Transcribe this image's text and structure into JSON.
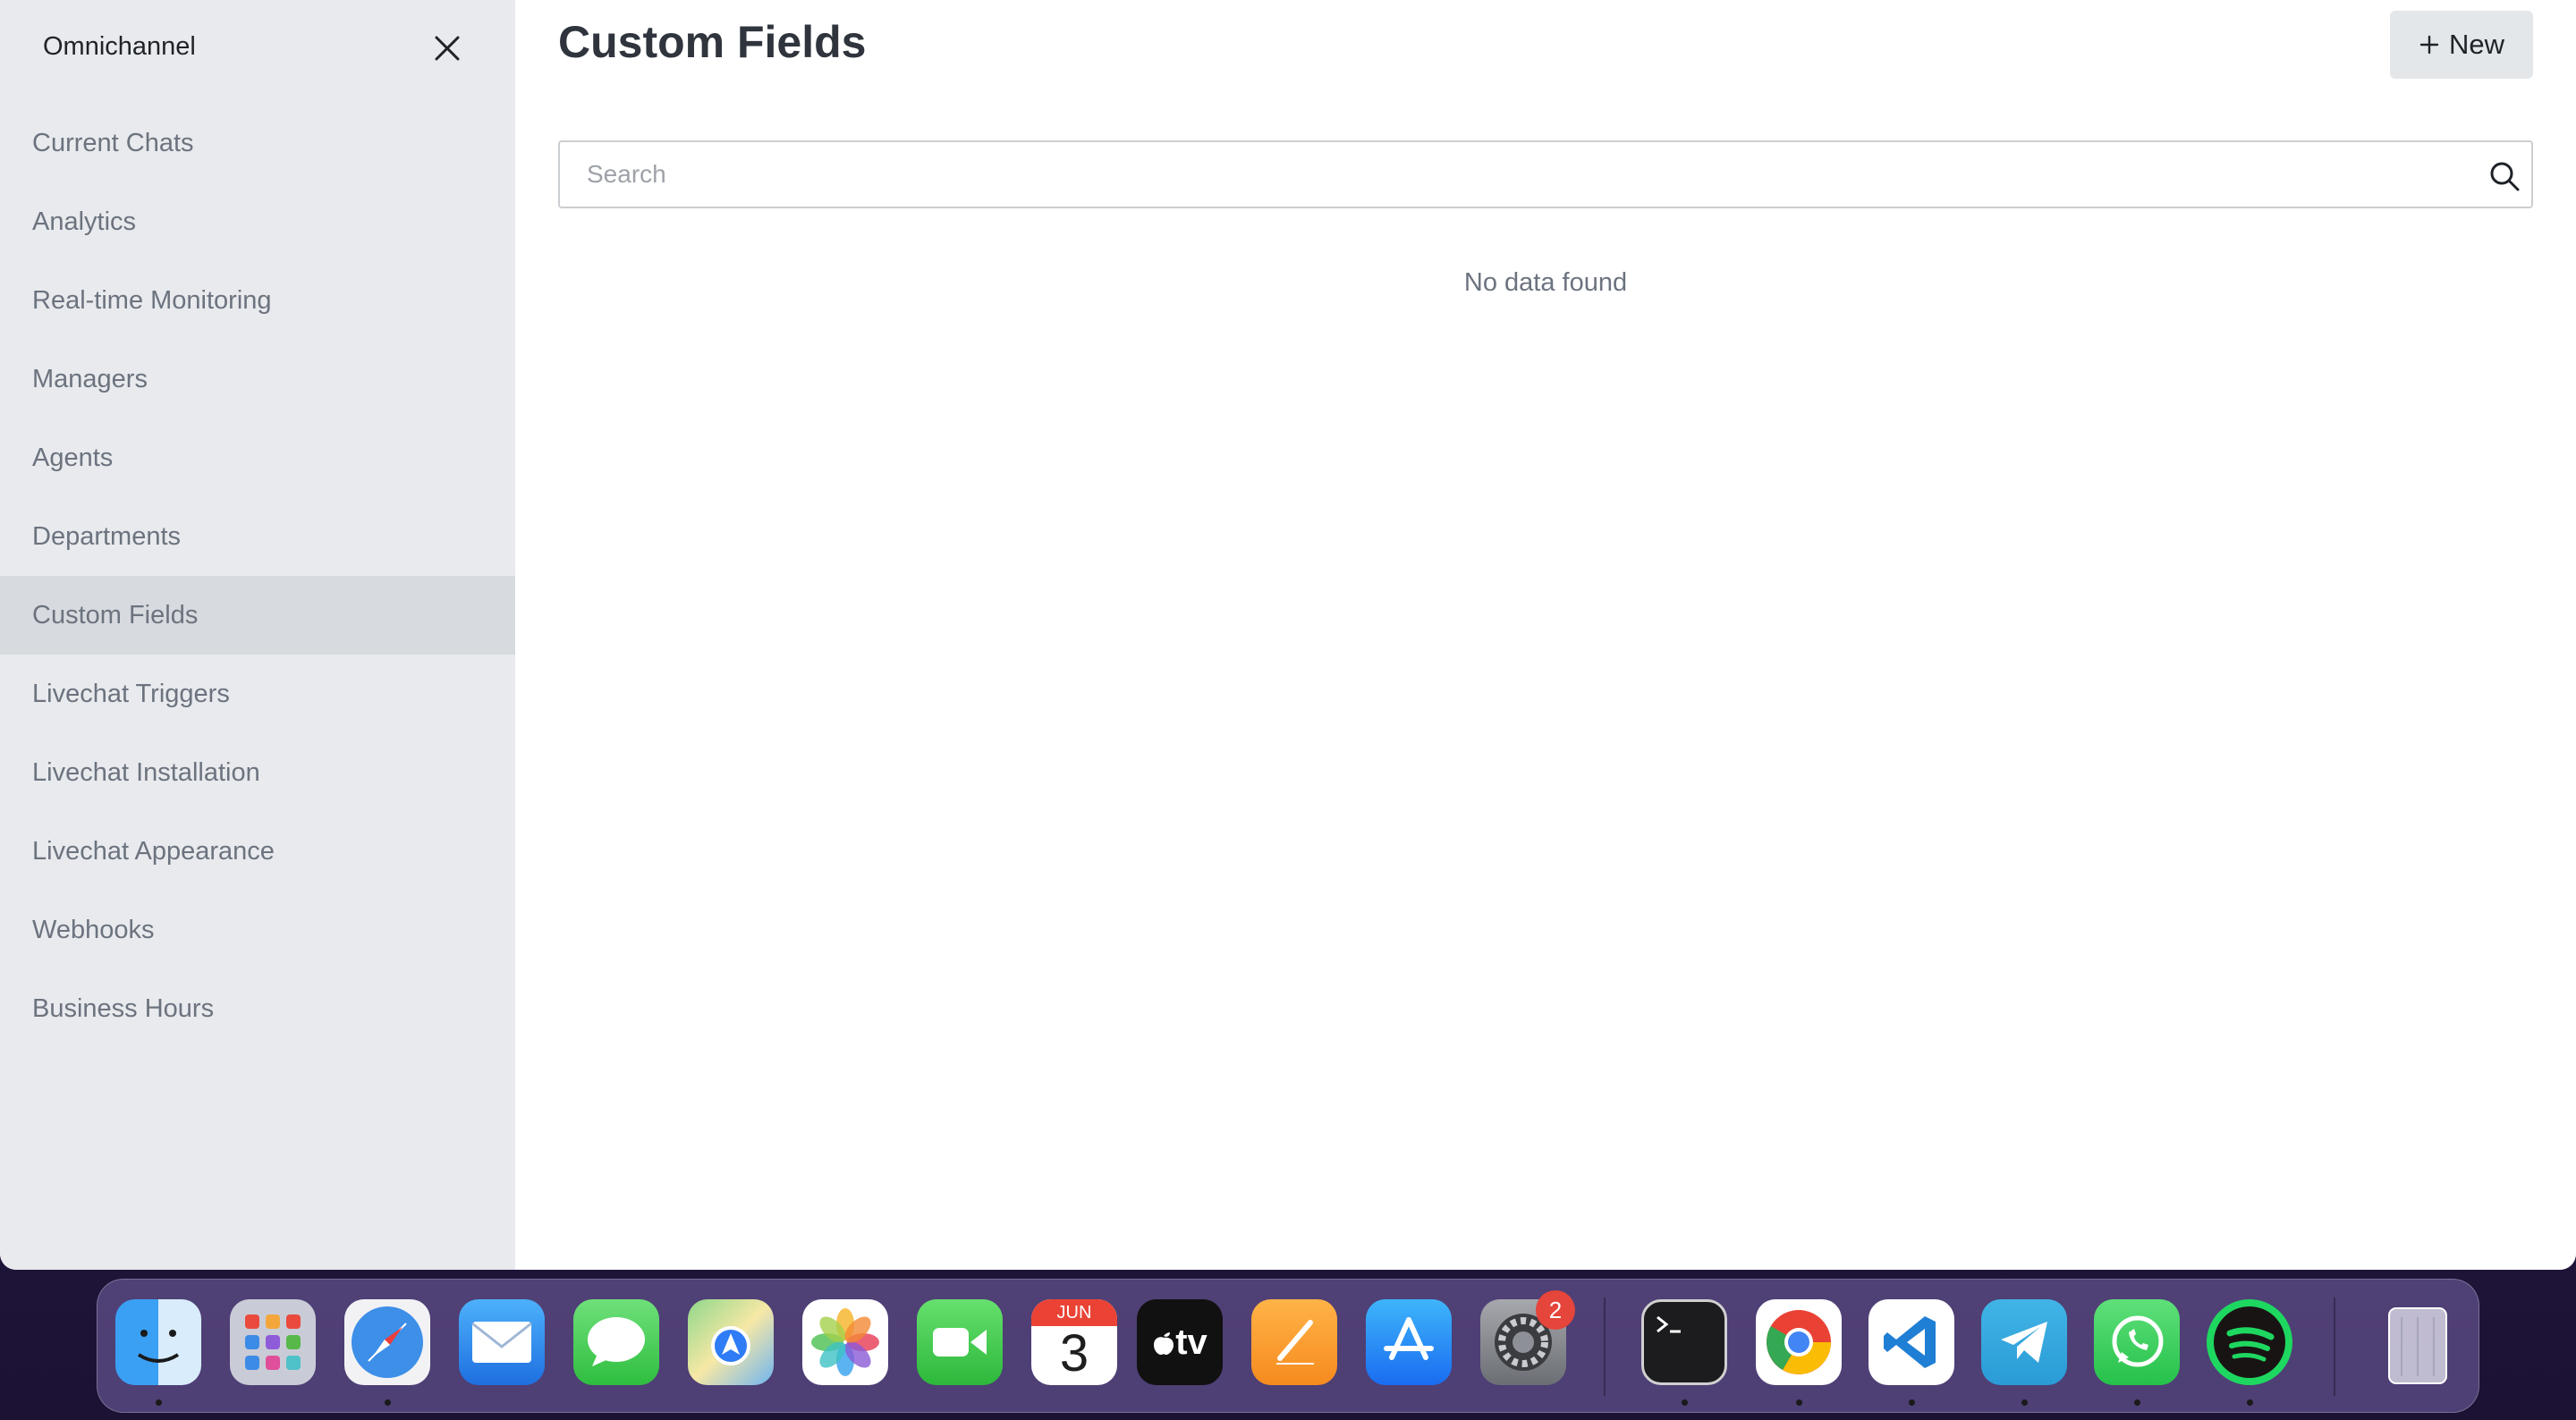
{
  "sidebar": {
    "title": "Omnichannel",
    "items": [
      {
        "label": "Current Chats"
      },
      {
        "label": "Analytics"
      },
      {
        "label": "Real-time Monitoring"
      },
      {
        "label": "Managers"
      },
      {
        "label": "Agents"
      },
      {
        "label": "Departments"
      },
      {
        "label": "Custom Fields",
        "active": true
      },
      {
        "label": "Livechat Triggers"
      },
      {
        "label": "Livechat Installation"
      },
      {
        "label": "Livechat Appearance"
      },
      {
        "label": "Webhooks"
      },
      {
        "label": "Business Hours"
      }
    ]
  },
  "main": {
    "title": "Custom Fields",
    "new_label": "New",
    "search_placeholder": "Search",
    "empty_message": "No data found"
  },
  "dock": {
    "calendar_month": "JUN",
    "calendar_day": "3",
    "tv_label": "tv",
    "settings_badge": "2",
    "apps": [
      "finder-icon",
      "launchpad-icon",
      "safari-icon",
      "mail-icon",
      "messages-icon",
      "maps-icon",
      "photos-icon",
      "facetime-icon",
      "calendar-icon",
      "apple-tv-icon",
      "pages-icon",
      "app-store-icon",
      "system-settings-icon",
      "terminal-icon",
      "chrome-icon",
      "vscode-icon",
      "telegram-icon",
      "whatsapp-icon",
      "spotify-icon",
      "trash-icon"
    ]
  },
  "colors": {
    "sidebar_bg": "#e8eaed",
    "active_item_bg": "#d7dade",
    "title_text": "#2f343d",
    "muted_text": "#6c737f"
  }
}
